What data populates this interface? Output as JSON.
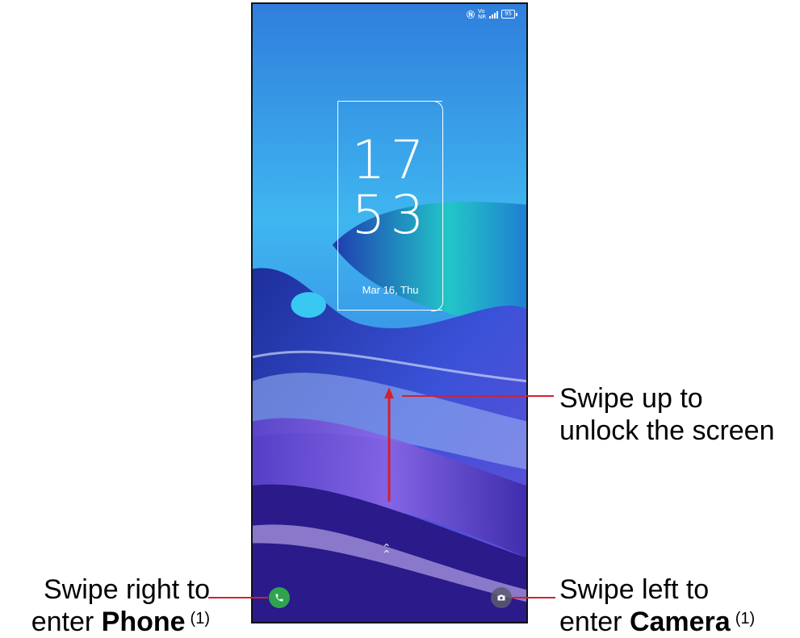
{
  "status_bar": {
    "icons": [
      "nfc-icon",
      "volte-icon",
      "5g-signal-icon",
      "battery-icon"
    ],
    "volte_top": "Vo",
    "volte_bottom": "NR",
    "network": "5G",
    "battery_level": "95"
  },
  "lock_screen": {
    "hour": "17",
    "minute": "53",
    "date": "Mar 16, Thu"
  },
  "shortcuts": {
    "left_icon": "phone-icon",
    "right_icon": "camera-icon",
    "swipe_indicator_icon": "chevron-up-icon"
  },
  "annotations": {
    "unlock_line1": "Swipe up to",
    "unlock_line2": "unlock the screen",
    "phone_line1": "Swipe right to",
    "phone_line2_prefix": "enter ",
    "phone_line2_bold": "Phone",
    "phone_footnote": "(1)",
    "camera_line1": "Swipe left to",
    "camera_line2_prefix": "enter ",
    "camera_line2_bold": "Camera",
    "camera_footnote": "(1)"
  },
  "colors": {
    "annotation_line": "#d6202a",
    "phone_button": "#2ea44f",
    "wallpaper_top": "#3fa6ea",
    "wallpaper_bottom": "#2a1a8a"
  }
}
